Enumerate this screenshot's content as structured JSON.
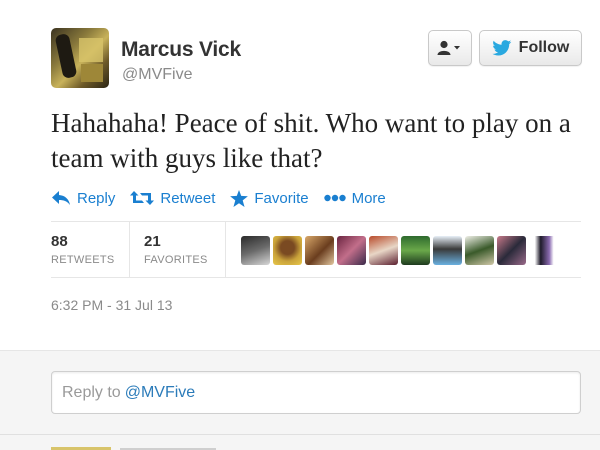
{
  "tweet": {
    "author_name": "Marcus Vick",
    "author_handle": "@MVFive",
    "text": "Hahahaha! Peace of shit. Who want to play on a team with guys like that?",
    "timestamp": "6:32 PM - 31 Jul 13"
  },
  "buttons": {
    "follow_label": "Follow",
    "user_menu_icon": "user-dropdown-icon"
  },
  "actions": {
    "reply": "Reply",
    "retweet": "Retweet",
    "favorite": "Favorite",
    "more": "More"
  },
  "stats": {
    "retweets_count": "88",
    "retweets_label": "RETWEETS",
    "favorites_count": "21",
    "favorites_label": "FAVORITES"
  },
  "reply_box": {
    "prefix": "Reply to",
    "mention": "@MVFive"
  },
  "colors": {
    "link_blue": "#1a7fd0",
    "twitter_bird_blue": "#2aa9e0",
    "muted_gray": "#8a8a8a"
  }
}
